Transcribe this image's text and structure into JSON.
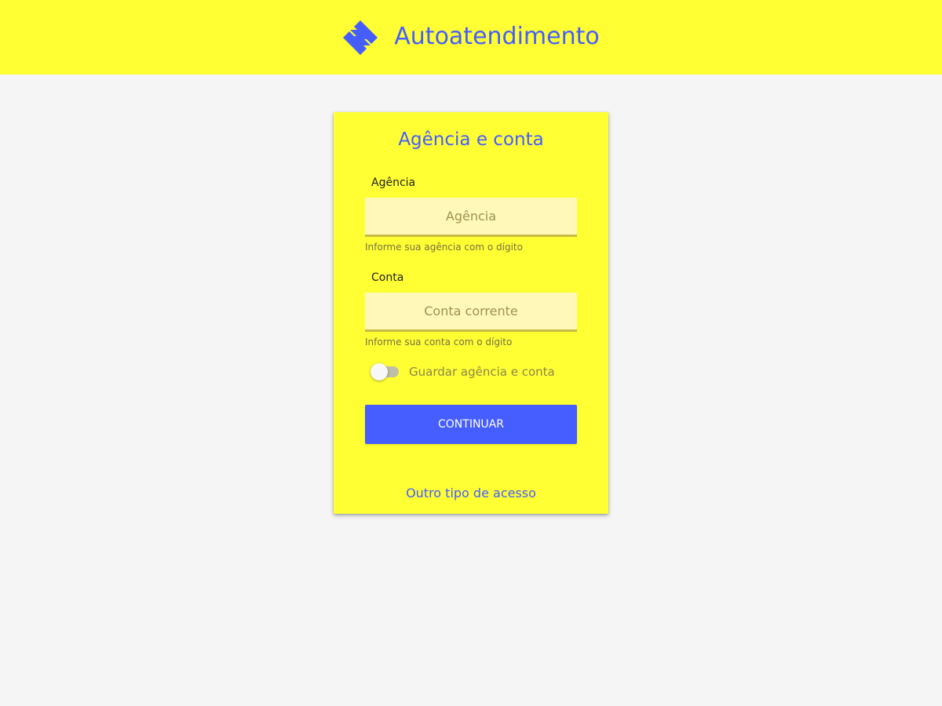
{
  "header": {
    "logo_icon": "bank-logo-icon",
    "title": "Autoatendimento"
  },
  "login_card": {
    "title": "Agência e conta",
    "agency": {
      "label": "Agência",
      "placeholder": "Agência",
      "value": "",
      "helper": "Informe sua agência com o dígito"
    },
    "account": {
      "label": "Conta",
      "placeholder": "Conta corrente",
      "value": "",
      "helper": "Informe sua conta com o dígito"
    },
    "remember": {
      "label": "Guardar agência e conta",
      "checked": false
    },
    "continue_label": "CONTINUAR",
    "other_access_label": "Outro tipo de acesso"
  },
  "colors": {
    "header_background": "#ffff33",
    "page_background": "#f5f5f5",
    "brand_blue": "#465eff",
    "input_background": "#fff8b8"
  }
}
